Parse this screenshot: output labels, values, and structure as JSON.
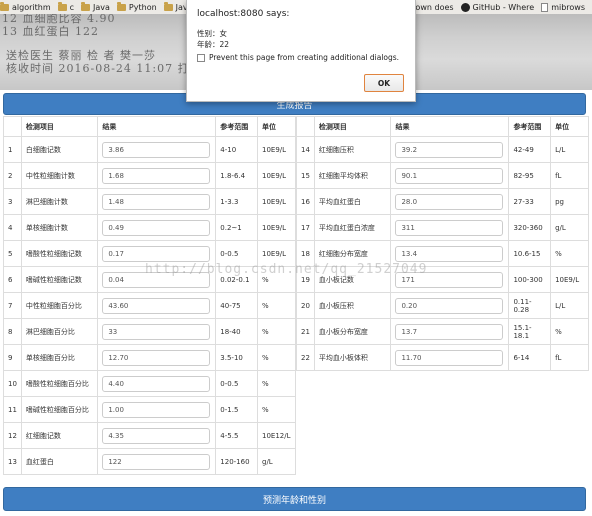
{
  "bookmarks": [
    {
      "label": "algorithm",
      "icon": "folder-icon"
    },
    {
      "label": "c",
      "icon": "folder-icon"
    },
    {
      "label": "Java",
      "icon": "folder-icon"
    },
    {
      "label": "Python",
      "icon": "folder-icon"
    },
    {
      "label": "JavaScrip",
      "icon": "folder-icon"
    }
  ],
  "bookmarks_right": [
    {
      "label": "hutdown does",
      "icon": "page-icon"
    },
    {
      "label": "GitHub - Where",
      "icon": "github-icon"
    },
    {
      "label": "mibrows",
      "icon": "page-icon"
    }
  ],
  "photo": {
    "line1": "12 血细胞比容          4.90",
    "line2": "13 血红蛋白             122",
    "line3": "送检医生  蔡丽              检  者  樊一莎",
    "line4": "核收时间  2016-08-24 11:07        打印时间  2016-08-24 11:08"
  },
  "dialog": {
    "title": "localhost:8080 says:",
    "gender_line": "性别：女",
    "age_line": "年龄：22",
    "checkbox_label": "Prevent this page from creating additional dialogs.",
    "ok_label": "OK"
  },
  "generate_button": "生成报告",
  "predict_button": "预测年龄和性别",
  "watermark": "http://blog.csdn.net/qq_21527049",
  "table_headers": {
    "no": "",
    "name": "检测项目",
    "result": "结果",
    "ref": "参考范围",
    "unit": "单位"
  },
  "left_rows": [
    {
      "no": "1",
      "name": "白细胞记数",
      "value": "3.86",
      "ref": "4-10",
      "unit": "10E9/L"
    },
    {
      "no": "2",
      "name": "中性粒细胞计数",
      "value": "1.68",
      "ref": "1.8-6.4",
      "unit": "10E9/L"
    },
    {
      "no": "3",
      "name": "淋巴细胞计数",
      "value": "1.48",
      "ref": "1-3.3",
      "unit": "10E9/L"
    },
    {
      "no": "4",
      "name": "单核细胞计数",
      "value": "0.49",
      "ref": "0.2~1",
      "unit": "10E9/L"
    },
    {
      "no": "5",
      "name": "嗜酸性粒细胞记数",
      "value": "0.17",
      "ref": "0-0.5",
      "unit": "10E9/L"
    },
    {
      "no": "6",
      "name": "嗜碱性粒细胞记数",
      "value": "0.04",
      "ref": "0.02-0.1",
      "unit": "%"
    },
    {
      "no": "7",
      "name": "中性粒细胞百分比",
      "value": "43.60",
      "ref": "40-75",
      "unit": "%"
    },
    {
      "no": "8",
      "name": "淋巴细胞百分比",
      "value": "33",
      "ref": "18-40",
      "unit": "%"
    },
    {
      "no": "9",
      "name": "单核细胞百分比",
      "value": "12.70",
      "ref": "3.5-10",
      "unit": "%"
    },
    {
      "no": "10",
      "name": "嗜酸性粒细胞百分比",
      "value": "4.40",
      "ref": "0-0.5",
      "unit": "%"
    },
    {
      "no": "11",
      "name": "嗜碱性粒细胞百分比",
      "value": "1.00",
      "ref": "0-1.5",
      "unit": "%"
    },
    {
      "no": "12",
      "name": "红细胞记数",
      "value": "4.35",
      "ref": "4-5.5",
      "unit": "10E12/L"
    },
    {
      "no": "13",
      "name": "血红蛋白",
      "value": "122",
      "ref": "120-160",
      "unit": "g/L"
    }
  ],
  "right_rows": [
    {
      "no": "14",
      "name": "红细胞压积",
      "value": "39.2",
      "ref": "42-49",
      "unit": "L/L"
    },
    {
      "no": "15",
      "name": "红细胞平均体积",
      "value": "90.1",
      "ref": "82-95",
      "unit": "fL"
    },
    {
      "no": "16",
      "name": "平均血红蛋白",
      "value": "28.0",
      "ref": "27-33",
      "unit": "pg"
    },
    {
      "no": "17",
      "name": "平均血红蛋白浓度",
      "value": "311",
      "ref": "320-360",
      "unit": "g/L"
    },
    {
      "no": "18",
      "name": "红细胞分布宽度",
      "value": "13.4",
      "ref": "10.6-15",
      "unit": "%"
    },
    {
      "no": "19",
      "name": "血小板记数",
      "value": "171",
      "ref": "100-300",
      "unit": "10E9/L"
    },
    {
      "no": "20",
      "name": "血小板压积",
      "value": "0.20",
      "ref": "0.11-0.28",
      "unit": "L/L"
    },
    {
      "no": "21",
      "name": "血小板分布宽度",
      "value": "13.7",
      "ref": "15.1-18.1",
      "unit": "%"
    },
    {
      "no": "22",
      "name": "平均血小板体积",
      "value": "11.70",
      "ref": "6-14",
      "unit": "fL"
    }
  ]
}
